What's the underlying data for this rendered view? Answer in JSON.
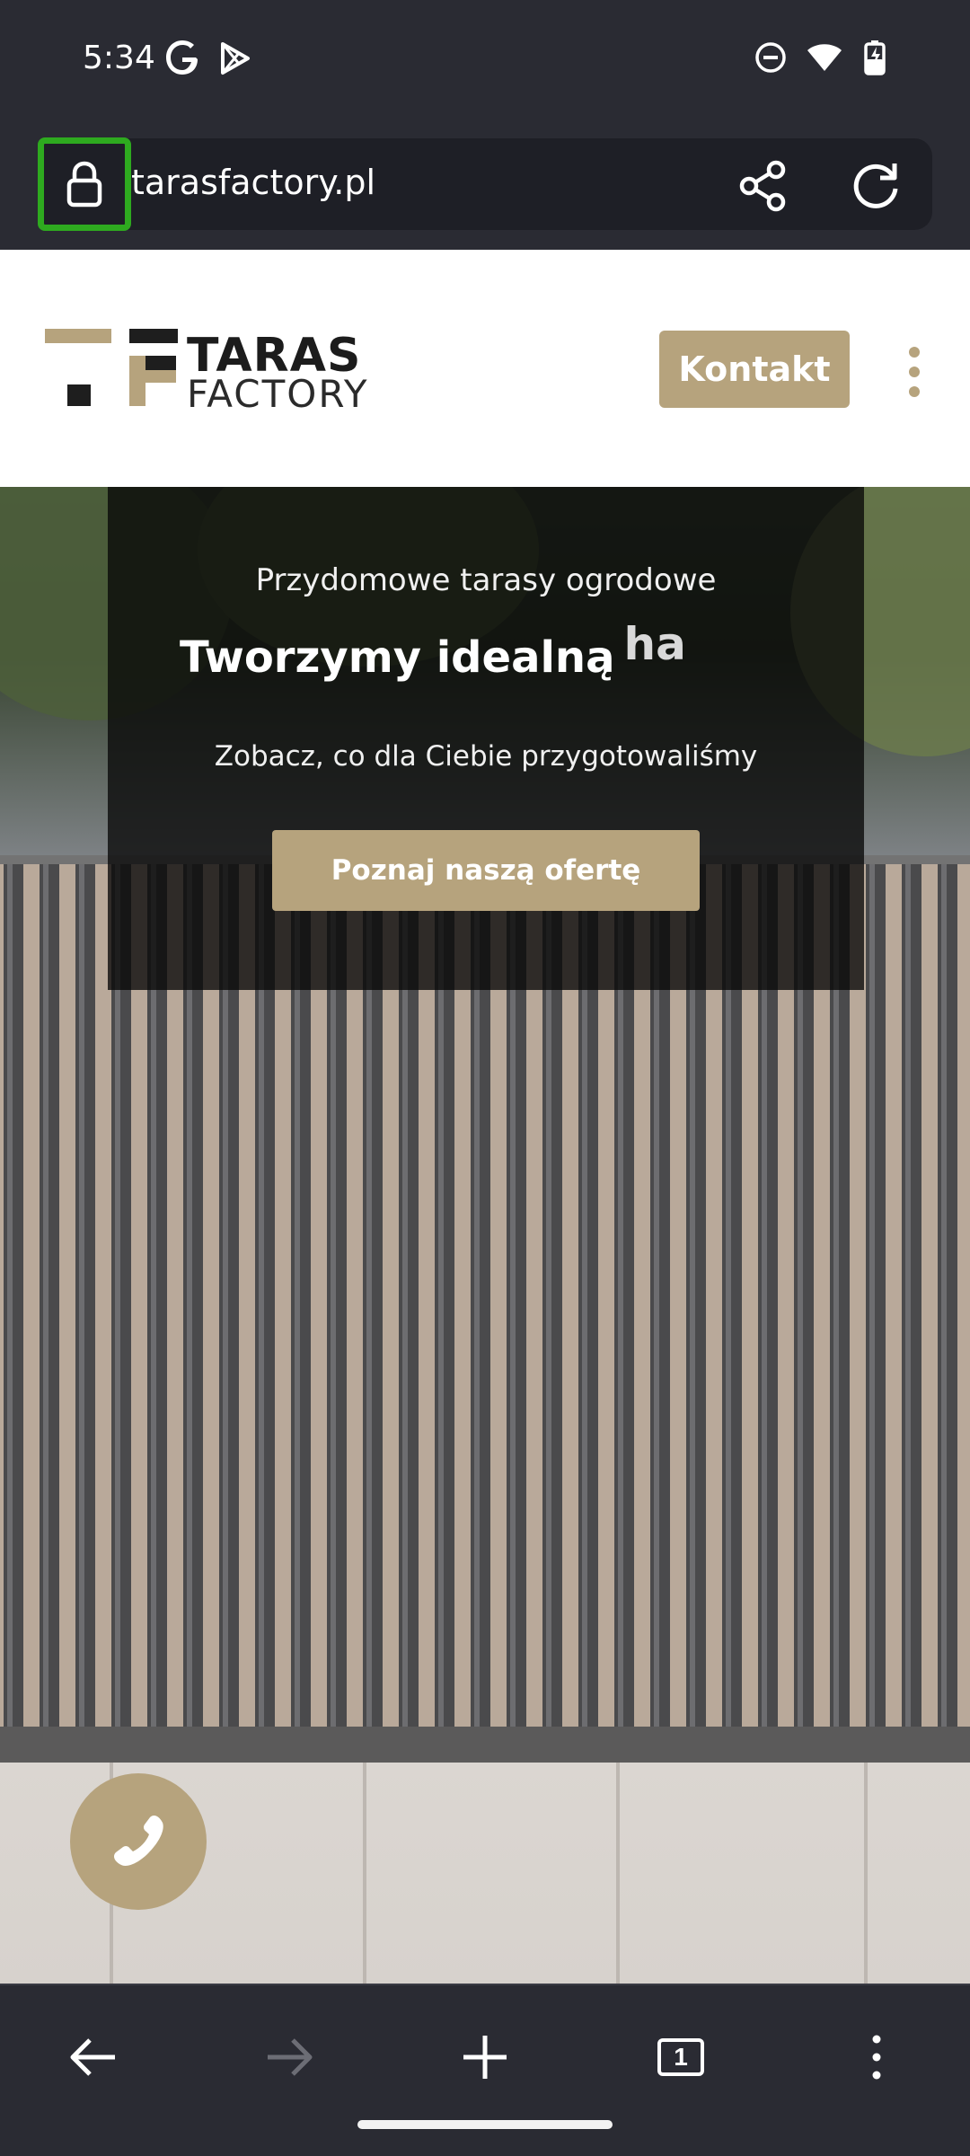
{
  "status_bar": {
    "time": "5:34",
    "icons": [
      "google-icon",
      "play-store-icon",
      "do-not-disturb-icon",
      "wifi-icon",
      "battery-charging-icon"
    ]
  },
  "browser": {
    "url": "tarasfactory.pl",
    "lock_icon": "lock-icon",
    "share_icon": "share-icon",
    "reload_icon": "reload-icon",
    "highlight_color": "#2eaa1f"
  },
  "site_header": {
    "logo_line1": "TARAS",
    "logo_line2": "FACTORY",
    "contact_button": "Kontakt",
    "menu_icon": "more-vert-icon",
    "accent_color": "#b6a37d"
  },
  "hero": {
    "subtitle": "Przydomowe tarasy ogrodowe",
    "title": "Tworzymy idealną",
    "typing_text": "ha",
    "description": "Zobacz, co dla Ciebie przygotowaliśmy",
    "cta_button": "Poznaj naszą ofertę"
  },
  "floating": {
    "phone_icon": "phone-icon"
  },
  "bottom_nav": {
    "back_icon": "back-arrow-icon",
    "forward_icon": "forward-arrow-icon",
    "new_tab_icon": "plus-icon",
    "tab_count": "1",
    "menu_icon": "more-vert-icon"
  }
}
